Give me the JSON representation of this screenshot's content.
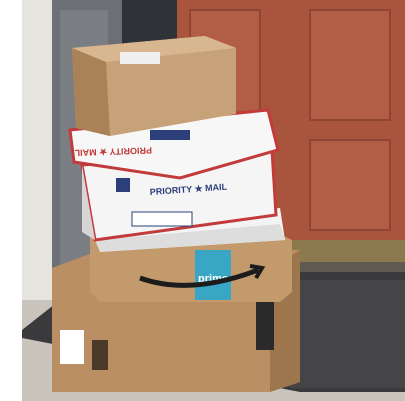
{
  "photo": {
    "box_labels": {
      "priority_mail_top": "PRIORITY ★ MAIL",
      "priority_mail_middle": "PRIORITY ★ MAIL",
      "amazon_logo_text": "prime"
    },
    "colors": {
      "door": "#a9553e",
      "frame": "#3b3f45",
      "cardboard": "#b98f63",
      "priority_red": "#c23a3a",
      "priority_blue": "#2d3f7a",
      "amazon_tape": "#3aa6c6",
      "mat": "#3a3a3c",
      "floor": "#c9c5bd"
    }
  }
}
